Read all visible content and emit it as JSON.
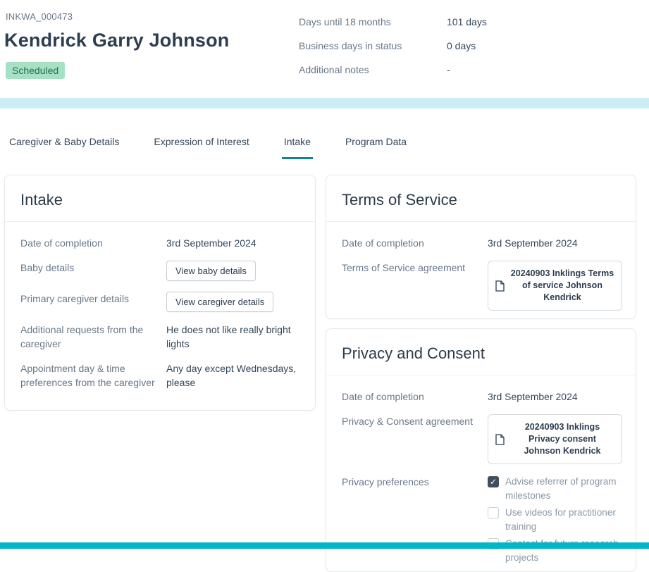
{
  "header": {
    "record_id": "INKWA_000473",
    "name": "Kendrick Garry Johnson",
    "status_badge": "Scheduled",
    "summary": [
      {
        "label": "Days until 18 months",
        "value": "101 days"
      },
      {
        "label": "Business days in status",
        "value": "0 days"
      },
      {
        "label": "Additional notes",
        "value": "-"
      }
    ]
  },
  "tabs": [
    {
      "label": "Caregiver & Baby Details",
      "active": false
    },
    {
      "label": "Expression of Interest",
      "active": false
    },
    {
      "label": "Intake",
      "active": true
    },
    {
      "label": "Program Data",
      "active": false
    }
  ],
  "intake": {
    "title": "Intake",
    "date_label": "Date of completion",
    "date_value": "3rd September 2024",
    "baby_label": "Baby details",
    "baby_button": "View baby details",
    "caregiver_label": "Primary caregiver details",
    "caregiver_button": "View caregiver details",
    "requests_label": "Additional requests from the caregiver",
    "requests_value": "He does not like really bright lights",
    "appointment_label": "Appointment day & time preferences from the caregiver",
    "appointment_value": "Any day except Wednesdays, please"
  },
  "terms": {
    "title": "Terms of Service",
    "date_label": "Date of completion",
    "date_value": "3rd September 2024",
    "agreement_label": "Terms of Service agreement",
    "file_name": "20240903 Inklings Terms of service Johnson Kendrick"
  },
  "privacy": {
    "title": "Privacy and Consent",
    "date_label": "Date of completion",
    "date_value": "3rd September 2024",
    "agreement_label": "Privacy & Consent agreement",
    "file_name": "20240903 Inklings Privacy consent Johnson Kendrick",
    "preferences_label": "Privacy preferences",
    "options": [
      {
        "label": "Advise referrer of program milestones",
        "checked": true
      },
      {
        "label": "Use videos for practitioner training",
        "checked": false
      },
      {
        "label": "Contact for future research projects",
        "checked": false
      }
    ]
  },
  "colors": {
    "accent_teal": "#17818E",
    "band_cyan": "#CBEEF6",
    "footer_teal": "#00B7CA",
    "badge_bg": "#A6E1C5",
    "badge_text": "#216E55",
    "checkbox_checked": "#414F5C"
  }
}
